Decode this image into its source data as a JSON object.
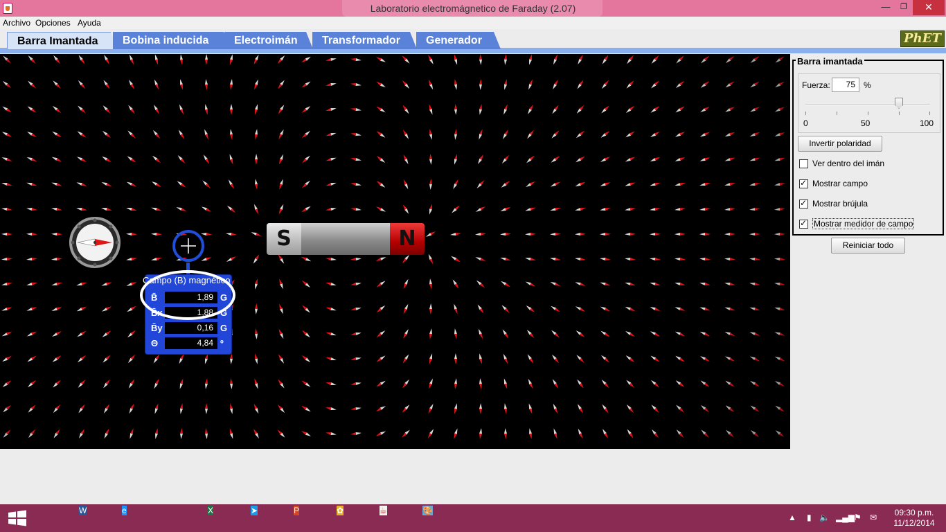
{
  "window": {
    "title": "Laboratorio electromágnetico de Faraday (2.07)"
  },
  "menu": {
    "items": [
      "Archivo",
      "Opciones",
      "Ayuda"
    ]
  },
  "tabs": [
    {
      "label": "Barra Imantada",
      "selected": true
    },
    {
      "label": "Bobina inducida",
      "selected": false
    },
    {
      "label": "Electroimán",
      "selected": false
    },
    {
      "label": "Transformador",
      "selected": false
    },
    {
      "label": "Generador",
      "selected": false
    }
  ],
  "logo": "PhET",
  "canvas": {
    "background": "#000000",
    "magnet": {
      "south_label": "S",
      "north_label": "N"
    },
    "field_meter": {
      "title": "Campo (B) magnético",
      "rows": [
        {
          "label": "B̄",
          "value": "1,89",
          "unit": "G"
        },
        {
          "label": "B̄x",
          "value": "1,88",
          "unit": "G"
        },
        {
          "label": "B̄y",
          "value": "0,16",
          "unit": "G"
        },
        {
          "label": "Θ",
          "value": "4,84",
          "unit": "º"
        }
      ]
    }
  },
  "control_panel": {
    "group_title": "Barra imantada",
    "strength": {
      "label": "Fuerza:",
      "value": "75",
      "unit": "%",
      "slider_value": 0.75,
      "ticks": [
        "0",
        "50",
        "100"
      ]
    },
    "invert_button": "Invertir polaridad",
    "checkboxes": [
      {
        "label": "Ver dentro del imán",
        "checked": false
      },
      {
        "label": "Mostrar campo",
        "checked": true
      },
      {
        "label": "Mostrar brújula",
        "checked": true
      },
      {
        "label": "Mostrar medidor de campo",
        "checked": true
      }
    ],
    "reset_button": "Reiniciar todo"
  },
  "taskbar": {
    "apps": [
      {
        "icon": "firefox-icon",
        "glyph": "",
        "color": "#e8721c"
      },
      {
        "icon": "word-icon",
        "glyph": "W",
        "color": "#2b579a"
      },
      {
        "icon": "internet-explorer-icon",
        "glyph": "e",
        "color": "#1e90ff"
      },
      {
        "icon": "file-explorer-icon",
        "glyph": "",
        "color": "#e9c46a"
      },
      {
        "icon": "excel-icon",
        "glyph": "X",
        "color": "#217346"
      },
      {
        "icon": "teamviewer-icon",
        "glyph": "➤",
        "color": "#1e9be6"
      },
      {
        "icon": "powerpoint-icon",
        "glyph": "P",
        "color": "#d24726"
      },
      {
        "icon": "app-icon",
        "glyph": "✿",
        "color": "#e9b02a"
      },
      {
        "icon": "java-icon",
        "glyph": "☕",
        "color": "#f2f2f2"
      },
      {
        "icon": "paint-icon",
        "glyph": "🎨",
        "color": "#6aa6d8"
      }
    ],
    "clock_time": "09:30 p.m.",
    "clock_date": "11/12/2014"
  }
}
